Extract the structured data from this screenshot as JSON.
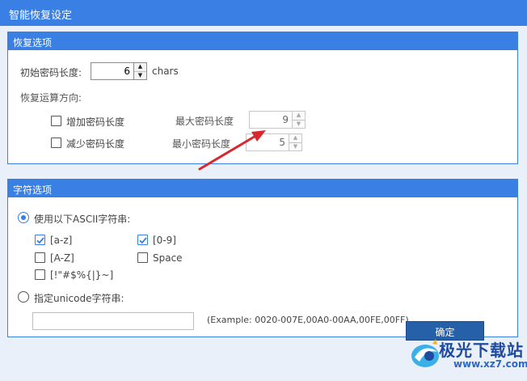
{
  "window": {
    "title": "智能恢复设定"
  },
  "recovery_options": {
    "header": "恢复选项",
    "initial_length_label": "初始密码长度:",
    "initial_length_value": "6",
    "initial_length_unit": "chars",
    "direction_label": "恢复运算方向:",
    "increase_label": "增加密码长度",
    "decrease_label": "减少密码长度",
    "max_length_label": "最大密码长度",
    "max_length_value": "9",
    "min_length_label": "最小密码长度",
    "min_length_value": "5",
    "increase_checked": false,
    "decrease_checked": false
  },
  "char_options": {
    "header": "字符选项",
    "ascii_label": "使用以下ASCII字符串:",
    "ascii_selected": true,
    "sets": [
      {
        "label": "[a-z]",
        "checked": true
      },
      {
        "label": "[0-9]",
        "checked": true
      },
      {
        "label": "[A-Z]",
        "checked": false
      },
      {
        "label": "Space",
        "checked": false
      },
      {
        "label": "[!\"#$%{|}~]",
        "checked": false
      }
    ],
    "unicode_label": "指定unicode字符串:",
    "unicode_selected": false,
    "unicode_value": "",
    "example_text": "(Example: 0020-007E,00A0-00AA,00FE,00FF)"
  },
  "footer": {
    "ok_label": "确定"
  },
  "watermark": {
    "brand": "极光下载站",
    "url": "www.xz7.com"
  },
  "colors": {
    "accent": "#3a7fe3",
    "button": "#2660a8",
    "annotation_arrow": "#d9272e"
  }
}
